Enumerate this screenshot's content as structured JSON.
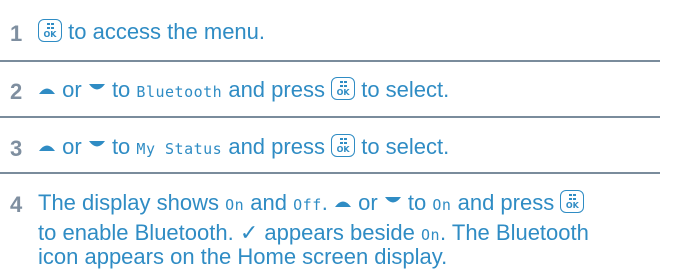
{
  "colors": {
    "text": "#2f8cc4",
    "step_number": "#7f8fa0",
    "rule": "#7a8c9c"
  },
  "icons": {
    "ok_key": "menu-ok-key-icon",
    "up": "up-arrow-icon",
    "down": "down-arrow-icon",
    "check": "checkmark-icon"
  },
  "steps": [
    {
      "number": "1",
      "text_a": "to access the menu."
    },
    {
      "number": "2",
      "or": "or",
      "text_to": "to",
      "lcd_item": "Bluetooth",
      "text_press": "and press",
      "text_select": "to select."
    },
    {
      "number": "3",
      "or": "or",
      "text_to": "to",
      "lcd_item": "My Status",
      "text_press": "and press",
      "text_select": "to select."
    },
    {
      "number": "4",
      "line1_a": "The display shows",
      "lcd_on": "On",
      "line1_and": "and",
      "lcd_off": "Off",
      "line1_dot": ".",
      "or": "or",
      "text_to": "to",
      "lcd_on2": "On",
      "text_press": "and press",
      "line2_a": "to enable Bluetooth.",
      "check": "✓",
      "line2_b": "appears beside",
      "lcd_on3": "On",
      "line2_c": ".  The Bluetooth",
      "line3": "icon appears on the Home screen display."
    }
  ]
}
